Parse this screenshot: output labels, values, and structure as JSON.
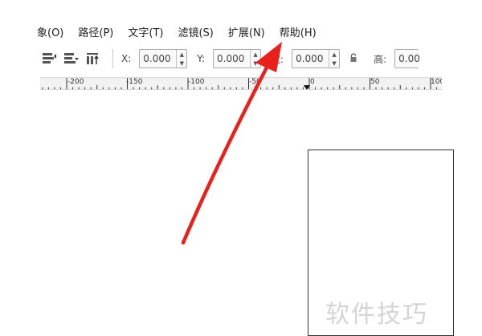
{
  "menu": {
    "items": [
      {
        "label": "象(O)"
      },
      {
        "label": "路径(P)"
      },
      {
        "label": "文字(T)"
      },
      {
        "label": "滤镜(S)"
      },
      {
        "label": "扩展(N)"
      },
      {
        "label": "帮助(H)"
      }
    ]
  },
  "toolbar": {
    "x_label": "X:",
    "x_value": "0.000",
    "y_label": "Y:",
    "y_value": "0.000",
    "w_label": "宽:",
    "w_value": "0.000",
    "h_label": "高:",
    "h_value": "0.00"
  },
  "ruler": {
    "labels": [
      "-200",
      "-150",
      "-100",
      "-50",
      "0",
      "50",
      "100"
    ]
  },
  "watermark": "软件技巧",
  "colors": {
    "arrow": "#e8211d",
    "ruler_bg": "#f2f2f2"
  }
}
